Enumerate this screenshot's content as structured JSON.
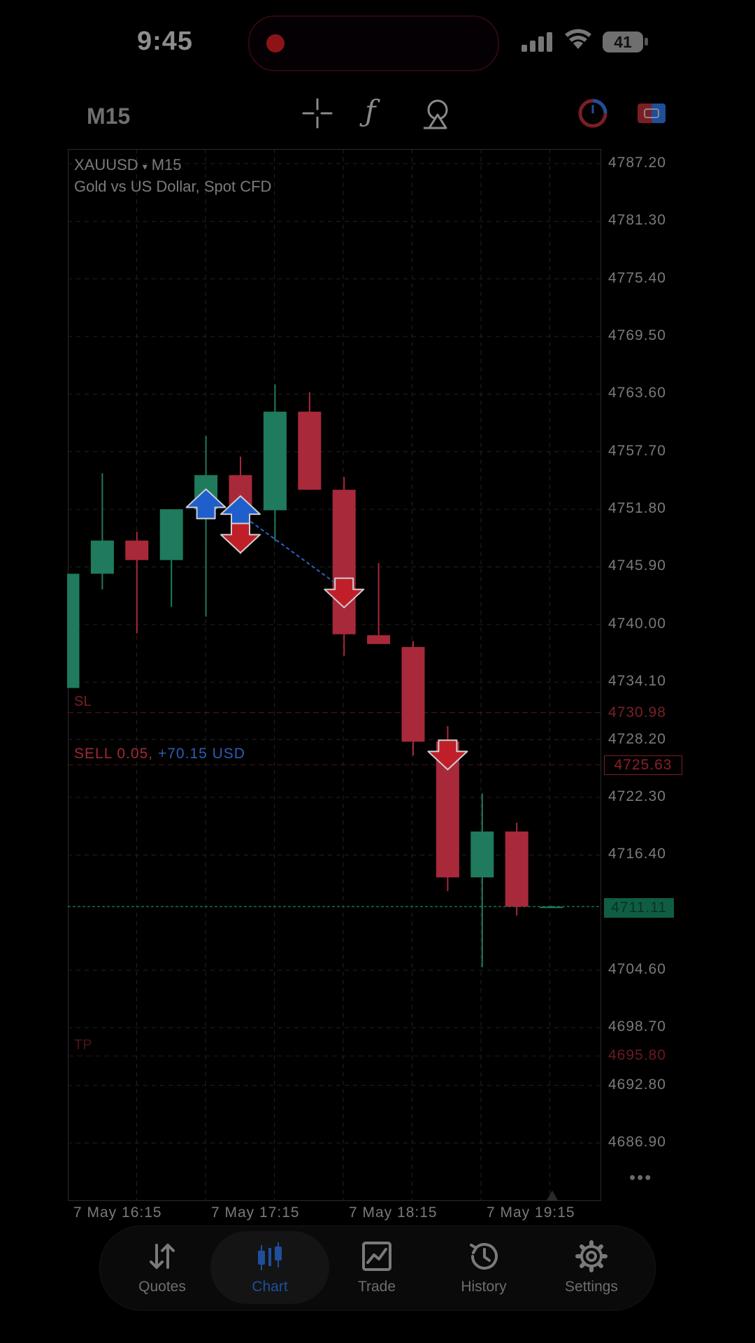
{
  "status_bar": {
    "time": "9:45",
    "battery": "41"
  },
  "toolbar": {
    "timeframe": "M15",
    "function_glyph": "ƒ"
  },
  "chart": {
    "symbol": "XAUUSD",
    "symbol_arrow": "▾",
    "symbol_timeframe": "M15",
    "description": "Gold vs US Dollar, Spot CFD",
    "sl_label": "SL",
    "tp_label": "TP",
    "order": {
      "side": "SELL 0.05,",
      "profit": "+70.15 USD"
    },
    "sl_price": "4730.98",
    "tp_price": "4695.80",
    "entry_price": "4725.63",
    "current_price": "4711.11",
    "more": "•••"
  },
  "chart_data": {
    "type": "candlestick",
    "y_ticks": [
      "4787.20",
      "4781.30",
      "4775.40",
      "4769.50",
      "4763.60",
      "4757.70",
      "4751.80",
      "4745.90",
      "4740.00",
      "4734.10",
      "4728.20",
      "4722.30",
      "4716.40",
      "4704.60",
      "4698.70",
      "4692.80",
      "4686.90"
    ],
    "x_ticks": [
      "7 May 16:15",
      "7 May 17:15",
      "7 May 18:15",
      "7 May 19:15"
    ],
    "ylim": [
      4683.4,
      4787.8
    ],
    "candles": [
      {
        "o": 4733.5,
        "h": 4745.2,
        "l": 4733.5,
        "c": 4745.2
      },
      {
        "o": 4745.2,
        "h": 4755.5,
        "l": 4743.6,
        "c": 4748.6
      },
      {
        "o": 4748.6,
        "h": 4749.5,
        "l": 4739.1,
        "c": 4746.6
      },
      {
        "o": 4746.6,
        "h": 4751.0,
        "l": 4741.8,
        "c": 4751.8
      },
      {
        "o": 4751.8,
        "h": 4759.3,
        "l": 4740.8,
        "c": 4755.3
      },
      {
        "o": 4755.3,
        "h": 4757.2,
        "l": 4747.2,
        "c": 4751.7
      },
      {
        "o": 4751.7,
        "h": 4764.6,
        "l": 4748.5,
        "c": 4761.8
      },
      {
        "o": 4761.8,
        "h": 4763.8,
        "l": 4753.8,
        "c": 4753.8
      },
      {
        "o": 4753.8,
        "h": 4755.1,
        "l": 4736.8,
        "c": 4739.0
      },
      {
        "o": 4738.9,
        "h": 4746.3,
        "l": 4738.9,
        "c": 4738.0
      },
      {
        "o": 4737.7,
        "h": 4738.3,
        "l": 4726.6,
        "c": 4728.0
      },
      {
        "o": 4728.0,
        "h": 4729.6,
        "l": 4712.7,
        "c": 4714.1
      },
      {
        "o": 4714.1,
        "h": 4722.7,
        "l": 4704.9,
        "c": 4718.8
      },
      {
        "o": 4718.8,
        "h": 4719.7,
        "l": 4710.2,
        "c": 4711.1
      },
      {
        "o": 4711.1,
        "h": 4711.2,
        "l": 4711.0,
        "c": 4711.1
      }
    ],
    "levels": {
      "sl": 4730.98,
      "entry": 4725.63,
      "current": 4711.11,
      "tp": 4695.8
    },
    "markers": [
      {
        "candle": 4,
        "type": "buy",
        "price": 4752.0
      },
      {
        "candle": 5,
        "type": "buy",
        "price": 4751.3
      },
      {
        "candle": 5,
        "type": "sell",
        "price": 4749.2
      },
      {
        "candle": 8,
        "type": "sell",
        "price": 4743.6
      },
      {
        "candle": 11,
        "type": "sell",
        "price": 4727.0
      }
    ],
    "colors": {
      "up": "#1f7a5e",
      "down": "#a8293a",
      "grid": "#222222",
      "sl": "#7a1e26",
      "current": "#1a8a66",
      "buy": "#1f5fcc",
      "sell": "#c01f2a"
    }
  },
  "tabs": [
    {
      "key": "quotes",
      "label": "Quotes"
    },
    {
      "key": "chart",
      "label": "Chart"
    },
    {
      "key": "trade",
      "label": "Trade"
    },
    {
      "key": "history",
      "label": "History"
    },
    {
      "key": "settings",
      "label": "Settings"
    }
  ]
}
